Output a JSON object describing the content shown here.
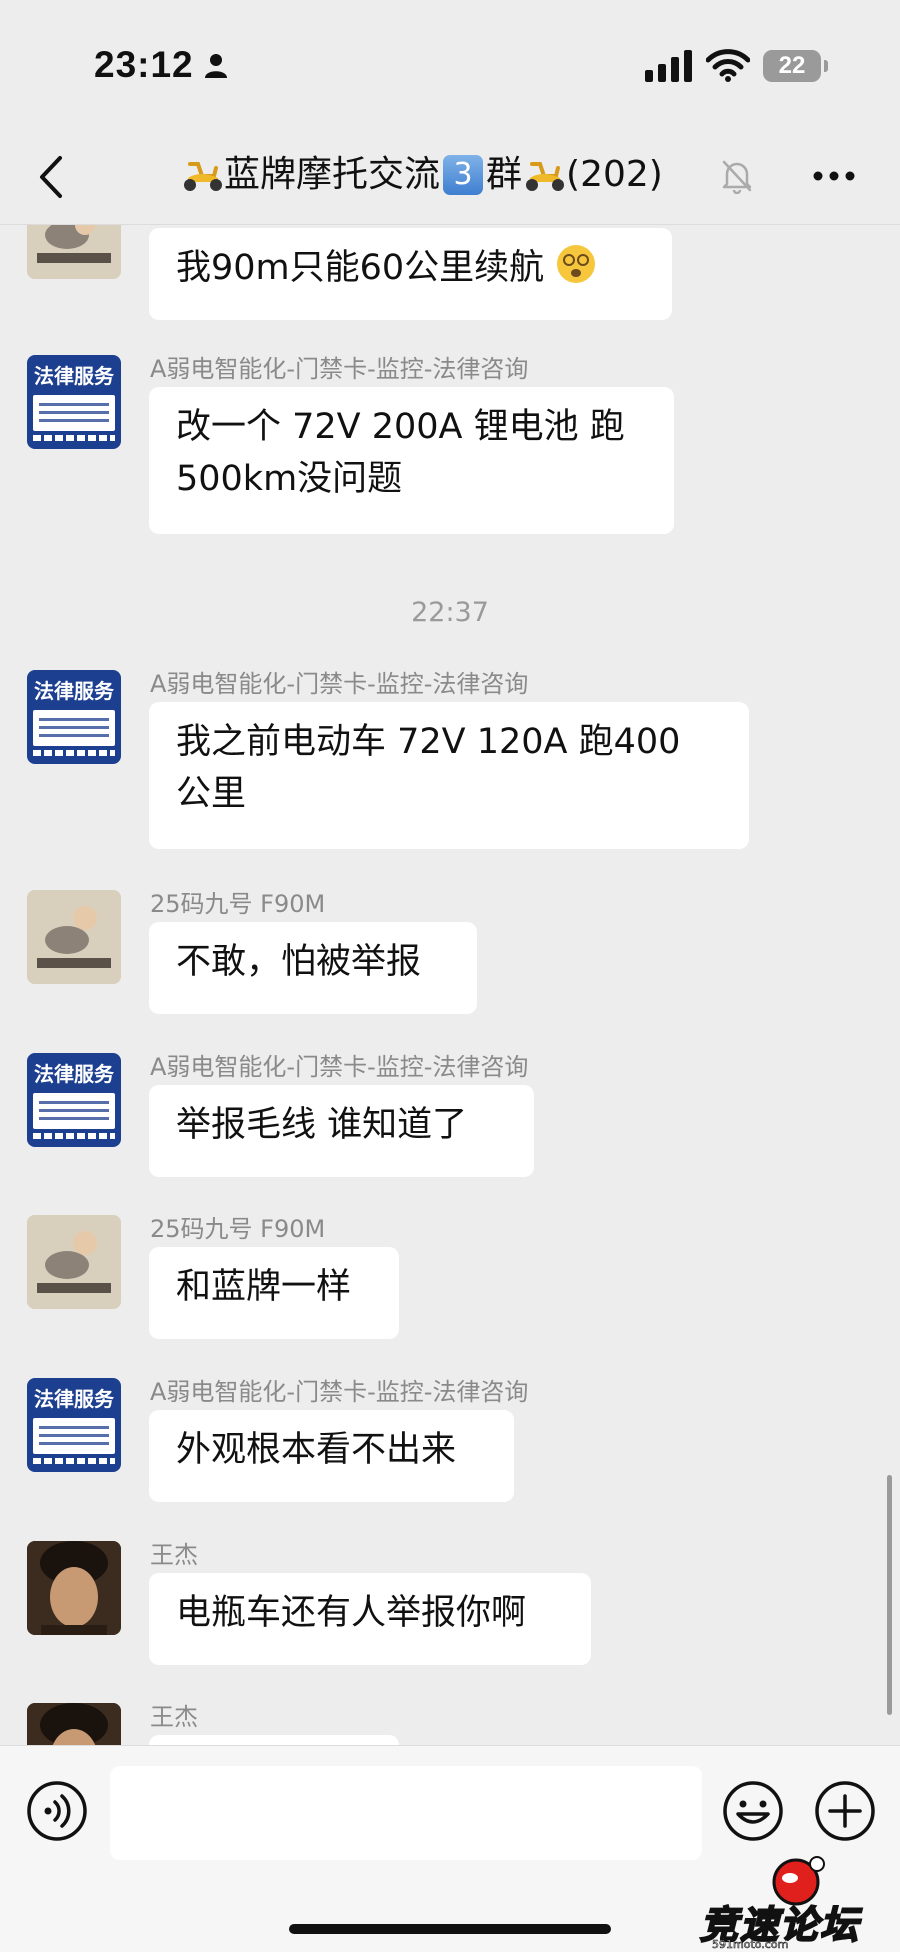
{
  "status_bar": {
    "time": "23:12",
    "battery": "22"
  },
  "header": {
    "title": "蓝牌摩托交流",
    "title_suffix": "群",
    "group_number": "3",
    "member_count": "(202)"
  },
  "time_divider": "22:37",
  "avatars": {
    "legal_text": "法律服务"
  },
  "messages": [
    {
      "sender": "",
      "text": "我90m只能60公里续航",
      "emoji": "dizzy-face"
    },
    {
      "sender": "A弱电智能化-门禁卡-监控-法律咨询",
      "text_line1": "改一个 72V 200A 锂电池 跑",
      "text_line2": "500km没问题"
    },
    {
      "sender": "A弱电智能化-门禁卡-监控-法律咨询",
      "text_line1": "我之前电动车 72V  120A 跑400",
      "text_line2": "公里"
    },
    {
      "sender": "25码九号 F90M",
      "text": "不敢，怕被举报"
    },
    {
      "sender": "A弱电智能化-门禁卡-监控-法律咨询",
      "text": "举报毛线  谁知道了"
    },
    {
      "sender": "25码九号 F90M",
      "text": "和蓝牌一样"
    },
    {
      "sender": "A弱电智能化-门禁卡-监控-法律咨询",
      "text": "外观根本看不出来"
    },
    {
      "sender": "王杰",
      "text": "电瓶车还有人举报你啊"
    },
    {
      "sender": "王杰",
      "text": ""
    }
  ],
  "input": {
    "value": ""
  },
  "watermark": {
    "text": "竞速论坛",
    "sub": "591moto.com"
  }
}
